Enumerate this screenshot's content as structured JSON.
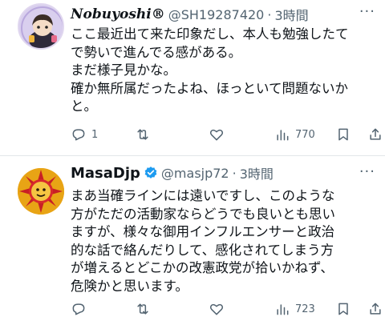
{
  "tweets": [
    {
      "name": "Nobuyoshi®",
      "handle": "@SH19287420",
      "time": "3時間",
      "body_lines": [
        "ここ最近出て来た印象だし、本人も勉強したて",
        "で勢いで進んでる感がある。",
        "まだ様子見かな。",
        "確か無所属だったよね、ほっといて問題ないか",
        "と。"
      ],
      "replies": "1",
      "retweets": "",
      "likes": "",
      "views": "770"
    },
    {
      "name": "MasaDjp",
      "handle": "@masjp72",
      "time": "3時間",
      "body_lines": [
        "まあ当確ラインには遠いですし、このような",
        "方がただの活動家ならどうでも良いとも思い",
        "ますが、様々な御用インフルエンサーと政治",
        "的な話で絡んだりして、感化されてしまう方",
        "が増えるとどこかの改憲政党が拾いかねず、",
        "危険かと思います。"
      ],
      "replies": "",
      "retweets": "",
      "likes": "",
      "views": "723"
    }
  ],
  "separator": "·",
  "icons": [
    "reply-icon",
    "retweet-icon",
    "like-icon",
    "views-icon",
    "bookmark-icon",
    "share-icon",
    "verified-badge-icon",
    "more-icon"
  ],
  "colors": {
    "text": "#0f1419",
    "secondary": "#536471",
    "verified": "#1d9bf0",
    "divider": "#e3e6e9"
  }
}
